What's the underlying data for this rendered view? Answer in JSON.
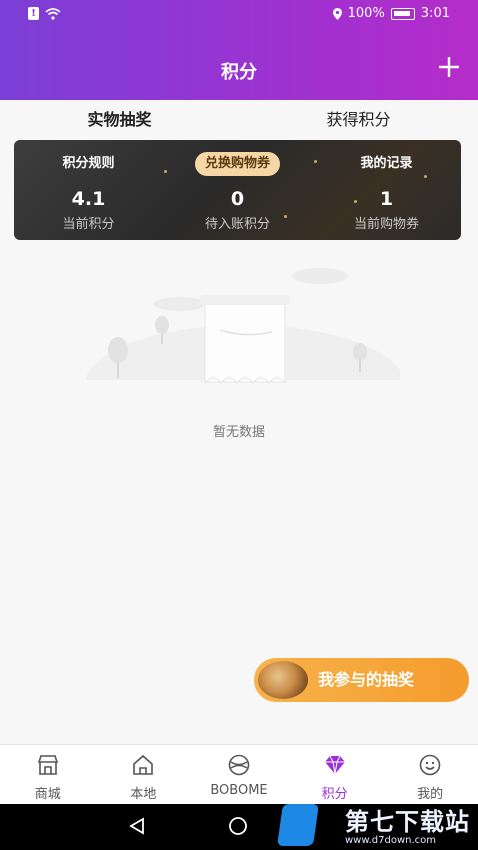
{
  "status_bar": {
    "battery": "100%",
    "time": "3:01",
    "sim_label": "!"
  },
  "header": {
    "title": "积分",
    "add_icon": "plus-icon"
  },
  "tabs": [
    {
      "label": "实物抽奖",
      "active": true
    },
    {
      "label": "获得积分",
      "active": false
    }
  ],
  "points_card": {
    "rules_label": "积分规则",
    "exchange_label": "兑换购物券",
    "records_label": "我的记录",
    "stats": [
      {
        "value": "4.1",
        "label": "当前积分"
      },
      {
        "value": "0",
        "label": "待入账积分"
      },
      {
        "value": "1",
        "label": "当前购物券"
      }
    ]
  },
  "empty_state": {
    "text": "暂无数据"
  },
  "floating_button": {
    "label": "我参与的抽奖"
  },
  "bottom_nav": [
    {
      "label": "商城",
      "icon": "store-icon"
    },
    {
      "label": "本地",
      "icon": "home-icon"
    },
    {
      "label": "BOBOME",
      "icon": "bobome-icon"
    },
    {
      "label": "积分",
      "icon": "diamond-icon",
      "active": true
    },
    {
      "label": "我的",
      "icon": "smiley-icon"
    }
  ],
  "watermark": {
    "brand": "第七下载站",
    "url": "www.d7down.com"
  },
  "colors": {
    "accent": "#9b30d6",
    "header_start": "#7b3fd6",
    "header_end": "#b52cc9",
    "button_orange": "#f59b2d"
  }
}
